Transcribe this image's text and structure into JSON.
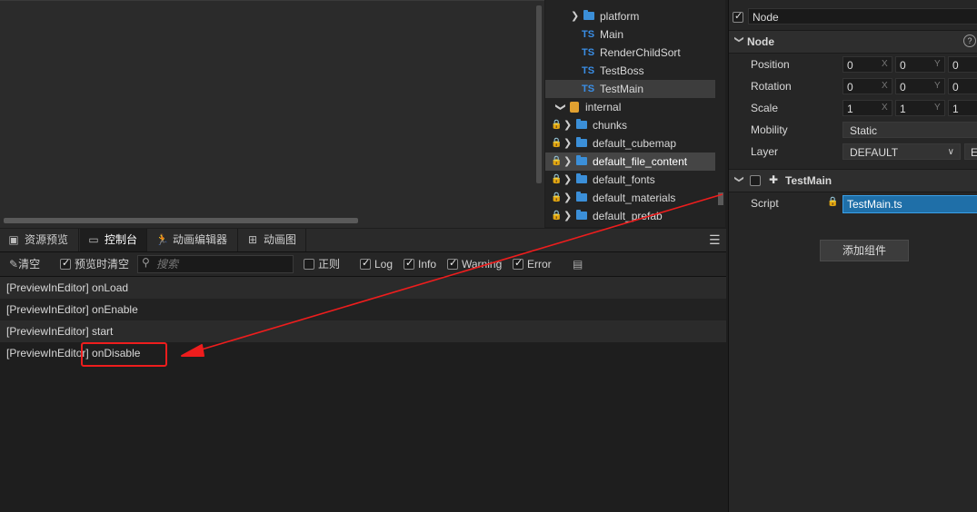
{
  "assets": {
    "items": [
      {
        "label": "platform",
        "kind": "folder",
        "expanded": false,
        "locked": false
      },
      {
        "label": "Main",
        "kind": "ts",
        "locked": false
      },
      {
        "label": "RenderChildSort",
        "kind": "ts",
        "locked": false
      },
      {
        "label": "TestBoss",
        "kind": "ts",
        "locked": false
      },
      {
        "label": "TestMain",
        "kind": "ts",
        "locked": false,
        "selected": true
      },
      {
        "label": "internal",
        "kind": "db",
        "expanded": true,
        "locked": false
      },
      {
        "label": "chunks",
        "kind": "folder",
        "expanded": false,
        "locked": true
      },
      {
        "label": "default_cubemap",
        "kind": "folder",
        "expanded": false,
        "locked": true
      },
      {
        "label": "default_file_content",
        "kind": "folder",
        "expanded": false,
        "locked": true,
        "highlighted": true
      },
      {
        "label": "default_fonts",
        "kind": "folder",
        "expanded": false,
        "locked": true
      },
      {
        "label": "default_materials",
        "kind": "folder",
        "expanded": false,
        "locked": true
      },
      {
        "label": "default_prefab",
        "kind": "folder",
        "expanded": false,
        "locked": true
      }
    ],
    "ts_badge": "TS"
  },
  "bottom_tabs": [
    {
      "label": "资源预览",
      "icon": "image-icon"
    },
    {
      "label": "控制台",
      "icon": "terminal-icon",
      "active": true
    },
    {
      "label": "动画编辑器",
      "icon": "running-icon"
    },
    {
      "label": "动画图",
      "icon": "graph-icon"
    }
  ],
  "console_toolbar": {
    "clear_label": "清空",
    "preview_clear_label": "预览时清空",
    "search_placeholder": "搜索",
    "regex_label": "正则",
    "filters": [
      {
        "label": "Log",
        "checked": true
      },
      {
        "label": "Info",
        "checked": true
      },
      {
        "label": "Warning",
        "checked": true
      },
      {
        "label": "Error",
        "checked": true
      }
    ]
  },
  "console_logs": [
    "[PreviewInEditor] onLoad",
    "[PreviewInEditor] onEnable",
    "[PreviewInEditor] start",
    "[PreviewInEditor] onDisable"
  ],
  "inspector": {
    "node_name": "Node",
    "node_section": "Node",
    "position": {
      "label": "Position",
      "x": "0",
      "y": "0",
      "z": "0"
    },
    "rotation": {
      "label": "Rotation",
      "x": "0",
      "y": "0",
      "z": "0"
    },
    "scale": {
      "label": "Scale",
      "x": "1",
      "y": "1",
      "z": "1"
    },
    "mobility": {
      "label": "Mobility",
      "value": "Static"
    },
    "layer": {
      "label": "Layer",
      "value": "DEFAULT",
      "edit": "E"
    },
    "component": {
      "name": "TestMain",
      "script_label": "Script",
      "script_value": "TestMain.ts"
    },
    "add_component": "添加组件",
    "axis_x": "X",
    "axis_y": "Y"
  },
  "colors": {
    "annotation": "#ee1d1d",
    "accent": "#3b8fd8",
    "selection": "#1f6fa8"
  }
}
